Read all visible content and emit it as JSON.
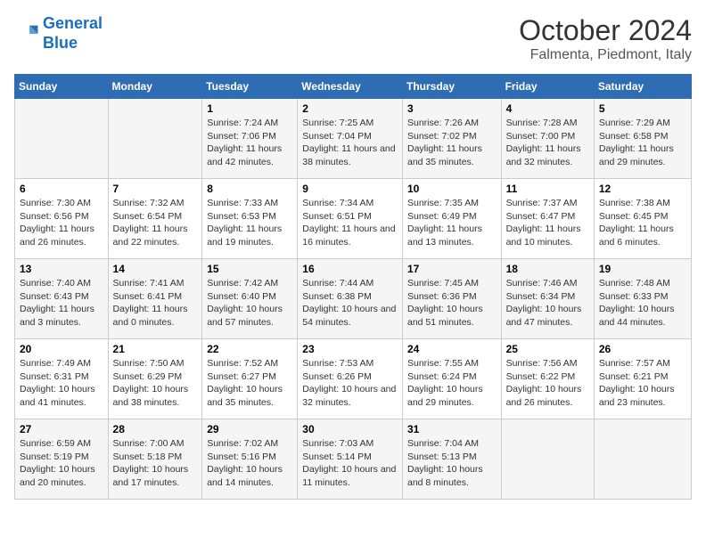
{
  "header": {
    "logo_line1": "General",
    "logo_line2": "Blue",
    "month_title": "October 2024",
    "location": "Falmenta, Piedmont, Italy"
  },
  "days_of_week": [
    "Sunday",
    "Monday",
    "Tuesday",
    "Wednesday",
    "Thursday",
    "Friday",
    "Saturday"
  ],
  "weeks": [
    [
      {
        "day": "",
        "sunrise": "",
        "sunset": "",
        "daylight": ""
      },
      {
        "day": "",
        "sunrise": "",
        "sunset": "",
        "daylight": ""
      },
      {
        "day": "1",
        "sunrise": "Sunrise: 7:24 AM",
        "sunset": "Sunset: 7:06 PM",
        "daylight": "Daylight: 11 hours and 42 minutes."
      },
      {
        "day": "2",
        "sunrise": "Sunrise: 7:25 AM",
        "sunset": "Sunset: 7:04 PM",
        "daylight": "Daylight: 11 hours and 38 minutes."
      },
      {
        "day": "3",
        "sunrise": "Sunrise: 7:26 AM",
        "sunset": "Sunset: 7:02 PM",
        "daylight": "Daylight: 11 hours and 35 minutes."
      },
      {
        "day": "4",
        "sunrise": "Sunrise: 7:28 AM",
        "sunset": "Sunset: 7:00 PM",
        "daylight": "Daylight: 11 hours and 32 minutes."
      },
      {
        "day": "5",
        "sunrise": "Sunrise: 7:29 AM",
        "sunset": "Sunset: 6:58 PM",
        "daylight": "Daylight: 11 hours and 29 minutes."
      }
    ],
    [
      {
        "day": "6",
        "sunrise": "Sunrise: 7:30 AM",
        "sunset": "Sunset: 6:56 PM",
        "daylight": "Daylight: 11 hours and 26 minutes."
      },
      {
        "day": "7",
        "sunrise": "Sunrise: 7:32 AM",
        "sunset": "Sunset: 6:54 PM",
        "daylight": "Daylight: 11 hours and 22 minutes."
      },
      {
        "day": "8",
        "sunrise": "Sunrise: 7:33 AM",
        "sunset": "Sunset: 6:53 PM",
        "daylight": "Daylight: 11 hours and 19 minutes."
      },
      {
        "day": "9",
        "sunrise": "Sunrise: 7:34 AM",
        "sunset": "Sunset: 6:51 PM",
        "daylight": "Daylight: 11 hours and 16 minutes."
      },
      {
        "day": "10",
        "sunrise": "Sunrise: 7:35 AM",
        "sunset": "Sunset: 6:49 PM",
        "daylight": "Daylight: 11 hours and 13 minutes."
      },
      {
        "day": "11",
        "sunrise": "Sunrise: 7:37 AM",
        "sunset": "Sunset: 6:47 PM",
        "daylight": "Daylight: 11 hours and 10 minutes."
      },
      {
        "day": "12",
        "sunrise": "Sunrise: 7:38 AM",
        "sunset": "Sunset: 6:45 PM",
        "daylight": "Daylight: 11 hours and 6 minutes."
      }
    ],
    [
      {
        "day": "13",
        "sunrise": "Sunrise: 7:40 AM",
        "sunset": "Sunset: 6:43 PM",
        "daylight": "Daylight: 11 hours and 3 minutes."
      },
      {
        "day": "14",
        "sunrise": "Sunrise: 7:41 AM",
        "sunset": "Sunset: 6:41 PM",
        "daylight": "Daylight: 11 hours and 0 minutes."
      },
      {
        "day": "15",
        "sunrise": "Sunrise: 7:42 AM",
        "sunset": "Sunset: 6:40 PM",
        "daylight": "Daylight: 10 hours and 57 minutes."
      },
      {
        "day": "16",
        "sunrise": "Sunrise: 7:44 AM",
        "sunset": "Sunset: 6:38 PM",
        "daylight": "Daylight: 10 hours and 54 minutes."
      },
      {
        "day": "17",
        "sunrise": "Sunrise: 7:45 AM",
        "sunset": "Sunset: 6:36 PM",
        "daylight": "Daylight: 10 hours and 51 minutes."
      },
      {
        "day": "18",
        "sunrise": "Sunrise: 7:46 AM",
        "sunset": "Sunset: 6:34 PM",
        "daylight": "Daylight: 10 hours and 47 minutes."
      },
      {
        "day": "19",
        "sunrise": "Sunrise: 7:48 AM",
        "sunset": "Sunset: 6:33 PM",
        "daylight": "Daylight: 10 hours and 44 minutes."
      }
    ],
    [
      {
        "day": "20",
        "sunrise": "Sunrise: 7:49 AM",
        "sunset": "Sunset: 6:31 PM",
        "daylight": "Daylight: 10 hours and 41 minutes."
      },
      {
        "day": "21",
        "sunrise": "Sunrise: 7:50 AM",
        "sunset": "Sunset: 6:29 PM",
        "daylight": "Daylight: 10 hours and 38 minutes."
      },
      {
        "day": "22",
        "sunrise": "Sunrise: 7:52 AM",
        "sunset": "Sunset: 6:27 PM",
        "daylight": "Daylight: 10 hours and 35 minutes."
      },
      {
        "day": "23",
        "sunrise": "Sunrise: 7:53 AM",
        "sunset": "Sunset: 6:26 PM",
        "daylight": "Daylight: 10 hours and 32 minutes."
      },
      {
        "day": "24",
        "sunrise": "Sunrise: 7:55 AM",
        "sunset": "Sunset: 6:24 PM",
        "daylight": "Daylight: 10 hours and 29 minutes."
      },
      {
        "day": "25",
        "sunrise": "Sunrise: 7:56 AM",
        "sunset": "Sunset: 6:22 PM",
        "daylight": "Daylight: 10 hours and 26 minutes."
      },
      {
        "day": "26",
        "sunrise": "Sunrise: 7:57 AM",
        "sunset": "Sunset: 6:21 PM",
        "daylight": "Daylight: 10 hours and 23 minutes."
      }
    ],
    [
      {
        "day": "27",
        "sunrise": "Sunrise: 6:59 AM",
        "sunset": "Sunset: 5:19 PM",
        "daylight": "Daylight: 10 hours and 20 minutes."
      },
      {
        "day": "28",
        "sunrise": "Sunrise: 7:00 AM",
        "sunset": "Sunset: 5:18 PM",
        "daylight": "Daylight: 10 hours and 17 minutes."
      },
      {
        "day": "29",
        "sunrise": "Sunrise: 7:02 AM",
        "sunset": "Sunset: 5:16 PM",
        "daylight": "Daylight: 10 hours and 14 minutes."
      },
      {
        "day": "30",
        "sunrise": "Sunrise: 7:03 AM",
        "sunset": "Sunset: 5:14 PM",
        "daylight": "Daylight: 10 hours and 11 minutes."
      },
      {
        "day": "31",
        "sunrise": "Sunrise: 7:04 AM",
        "sunset": "Sunset: 5:13 PM",
        "daylight": "Daylight: 10 hours and 8 minutes."
      },
      {
        "day": "",
        "sunrise": "",
        "sunset": "",
        "daylight": ""
      },
      {
        "day": "",
        "sunrise": "",
        "sunset": "",
        "daylight": ""
      }
    ]
  ]
}
